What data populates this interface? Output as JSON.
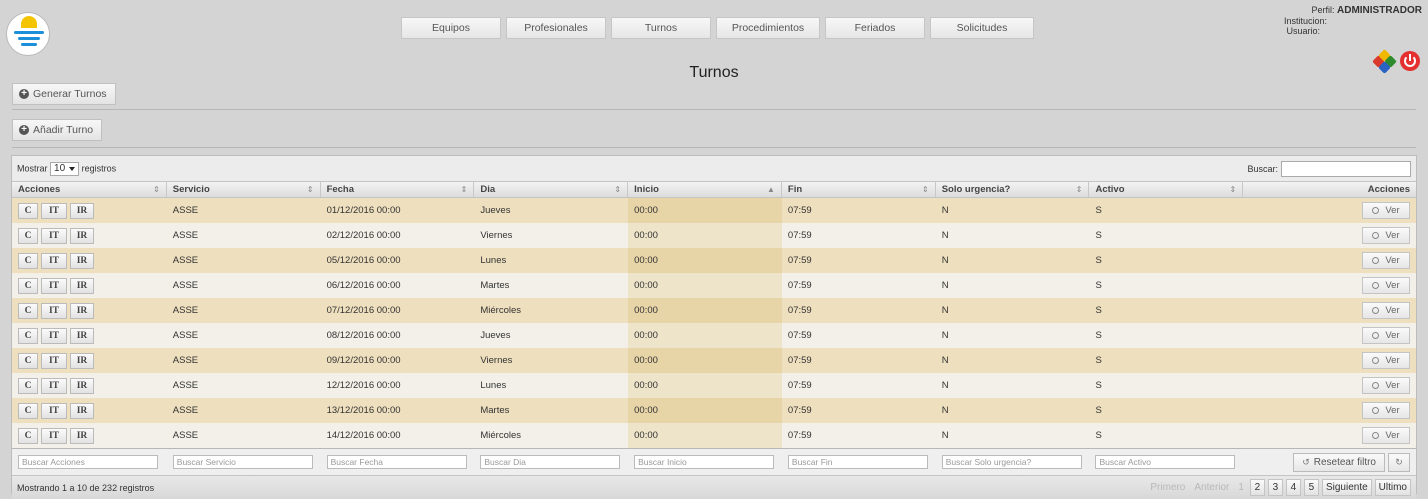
{
  "nav": {
    "items": [
      {
        "label": "Equipos",
        "w": 100
      },
      {
        "label": "Profesionales",
        "w": 100
      },
      {
        "label": "Turnos",
        "w": 100
      },
      {
        "label": "Procedimientos",
        "w": 104
      },
      {
        "label": "Feriados",
        "w": 100
      },
      {
        "label": "Solicitudes",
        "w": 104
      }
    ]
  },
  "user": {
    "perfil_label": "Perfil:",
    "perfil_value": "ADMINISTRADOR",
    "institucion_label": "Institucion:",
    "usuario_label": "Usuario:"
  },
  "page": {
    "title": "Turnos"
  },
  "actions": {
    "generar": "Generar Turnos",
    "anadir": "Añadir Turno"
  },
  "table": {
    "length": {
      "prefix": "Mostrar",
      "value": "10",
      "suffix": "registros"
    },
    "search_label": "Buscar:",
    "columns": [
      {
        "label": "Acciones",
        "sort": "⇕"
      },
      {
        "label": "Servicio",
        "sort": "⇕"
      },
      {
        "label": "Fecha",
        "sort": "⇕"
      },
      {
        "label": "Dia",
        "sort": "⇕"
      },
      {
        "label": "Inicio",
        "sort": "▲"
      },
      {
        "label": "Fin",
        "sort": "⇕"
      },
      {
        "label": "Solo urgencia?",
        "sort": "⇕"
      },
      {
        "label": "Activo",
        "sort": "⇕"
      },
      {
        "label": "Acciones",
        "sort": ""
      }
    ],
    "row_buttons": [
      "C",
      "IT",
      "IR"
    ],
    "ver_label": "Ver",
    "rows": [
      {
        "servicio": "ASSE",
        "fecha": "01/12/2016 00:00",
        "dia": "Jueves",
        "inicio": "00:00",
        "fin": "07:59",
        "urgencia": "N",
        "activo": "S"
      },
      {
        "servicio": "ASSE",
        "fecha": "02/12/2016 00:00",
        "dia": "Viernes",
        "inicio": "00:00",
        "fin": "07:59",
        "urgencia": "N",
        "activo": "S"
      },
      {
        "servicio": "ASSE",
        "fecha": "05/12/2016 00:00",
        "dia": "Lunes",
        "inicio": "00:00",
        "fin": "07:59",
        "urgencia": "N",
        "activo": "S"
      },
      {
        "servicio": "ASSE",
        "fecha": "06/12/2016 00:00",
        "dia": "Martes",
        "inicio": "00:00",
        "fin": "07:59",
        "urgencia": "N",
        "activo": "S"
      },
      {
        "servicio": "ASSE",
        "fecha": "07/12/2016 00:00",
        "dia": "Miércoles",
        "inicio": "00:00",
        "fin": "07:59",
        "urgencia": "N",
        "activo": "S"
      },
      {
        "servicio": "ASSE",
        "fecha": "08/12/2016 00:00",
        "dia": "Jueves",
        "inicio": "00:00",
        "fin": "07:59",
        "urgencia": "N",
        "activo": "S"
      },
      {
        "servicio": "ASSE",
        "fecha": "09/12/2016 00:00",
        "dia": "Viernes",
        "inicio": "00:00",
        "fin": "07:59",
        "urgencia": "N",
        "activo": "S"
      },
      {
        "servicio": "ASSE",
        "fecha": "12/12/2016 00:00",
        "dia": "Lunes",
        "inicio": "00:00",
        "fin": "07:59",
        "urgencia": "N",
        "activo": "S"
      },
      {
        "servicio": "ASSE",
        "fecha": "13/12/2016 00:00",
        "dia": "Martes",
        "inicio": "00:00",
        "fin": "07:59",
        "urgencia": "N",
        "activo": "S"
      },
      {
        "servicio": "ASSE",
        "fecha": "14/12/2016 00:00",
        "dia": "Miércoles",
        "inicio": "00:00",
        "fin": "07:59",
        "urgencia": "N",
        "activo": "S"
      }
    ],
    "filters": [
      "Buscar Acciones",
      "Buscar Servicio",
      "Buscar Fecha",
      "Buscar Dia",
      "Buscar  Inicio",
      "Buscar  Fin",
      "Buscar Solo urgencia?",
      "Buscar Activo"
    ],
    "reset_label": "Resetear filtro",
    "info": "Mostrando 1 a 10 de 232 registros",
    "pager": {
      "first": "Primero",
      "prev": "Anterior",
      "current": "1",
      "pages": [
        "2",
        "3",
        "4",
        "5"
      ],
      "next": "Siguiente",
      "last": "Ultimo"
    }
  },
  "colors": {
    "row_odd": "#eedfbe",
    "row_even": "#f2f0e8",
    "sorted_odd": "#e7d4a7",
    "sorted_even": "#ede4c9",
    "power": "#e53030",
    "logo_sun": "#f5c400",
    "logo_waves": "#1b8fd8"
  }
}
